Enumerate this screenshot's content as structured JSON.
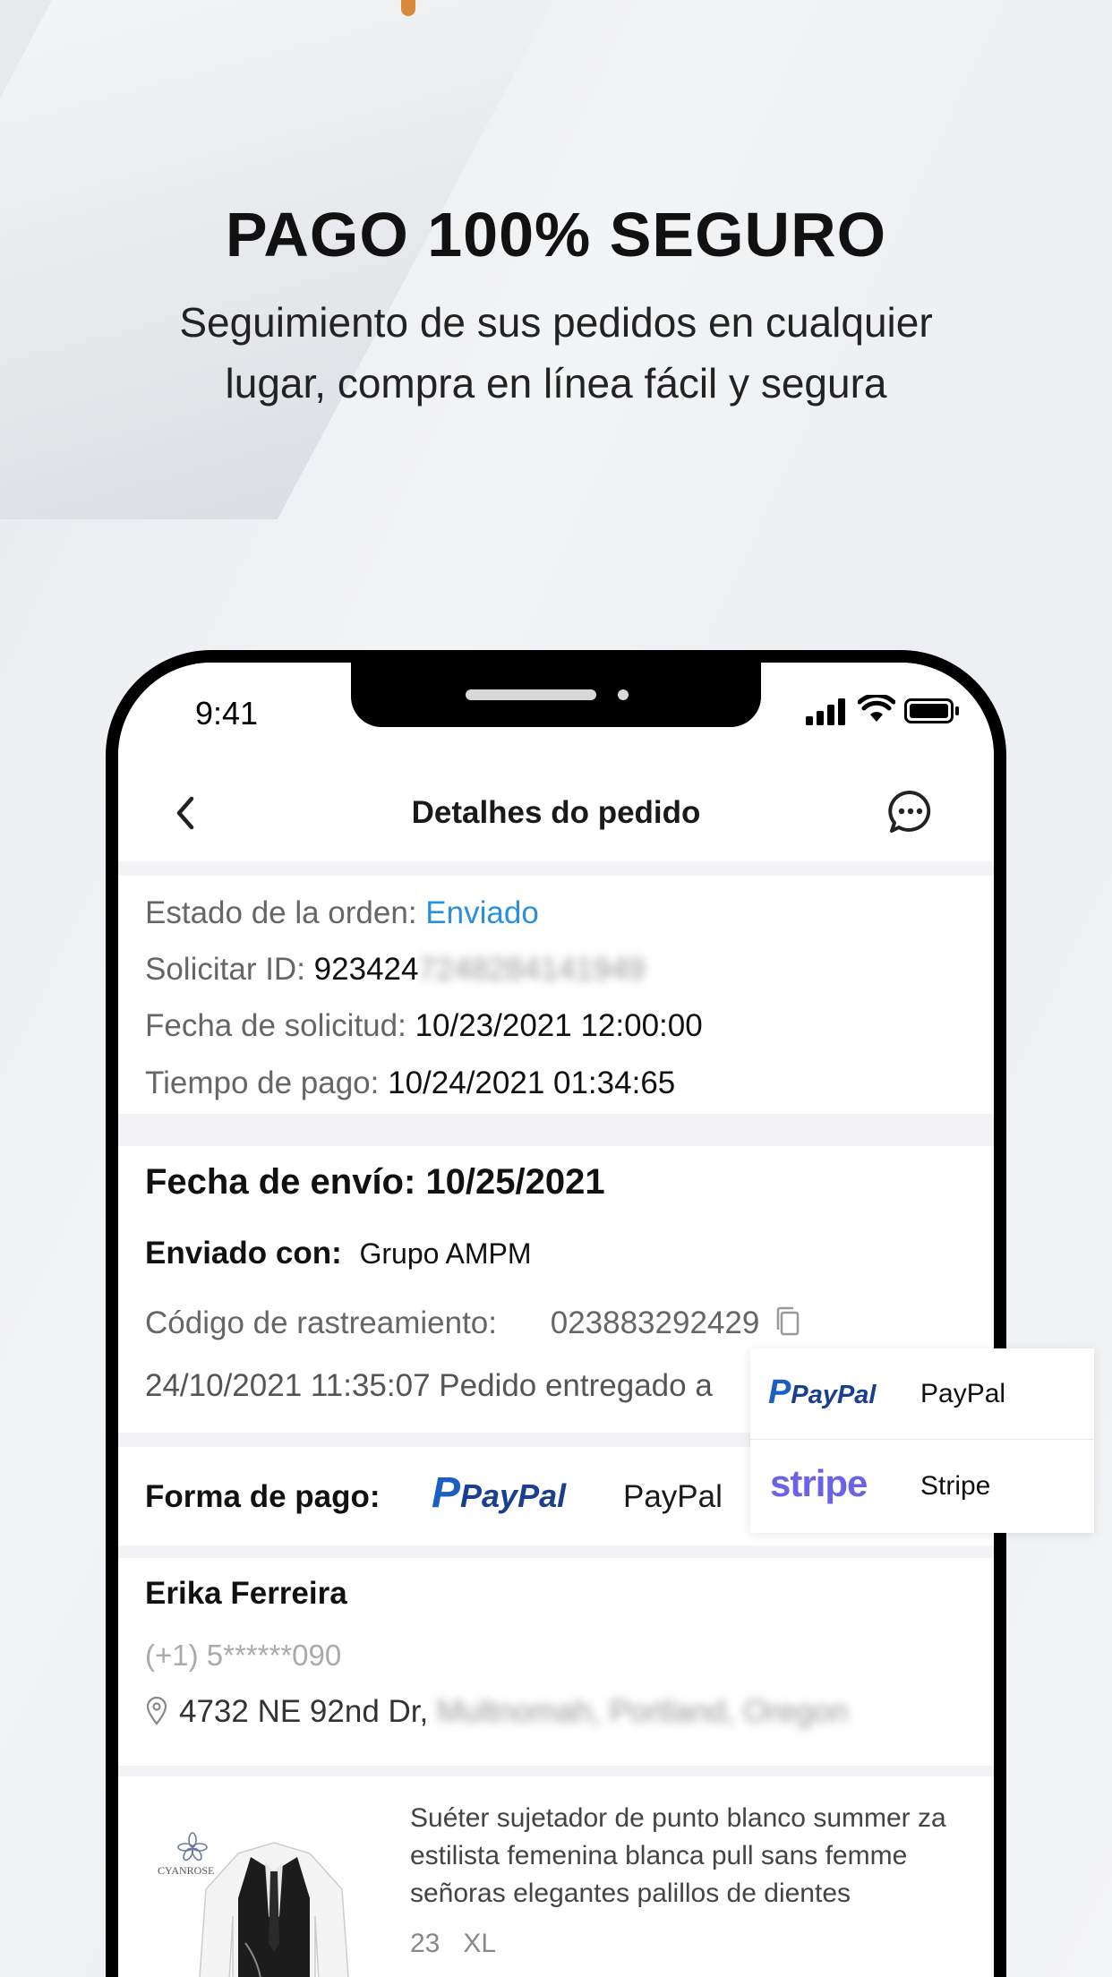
{
  "promo": {
    "headline": "PAGO 100% SEGURO",
    "subline": "Seguimiento de sus pedidos en cualquier lugar, compra en línea fácil y segura"
  },
  "status_bar": {
    "time": "9:41"
  },
  "nav": {
    "title": "Detalhes do pedido"
  },
  "order": {
    "status_label": "Estado de la orden:",
    "status_value": "Enviado",
    "id_label": "Solicitar ID:",
    "id_value": "923424",
    "id_hidden": "7248284141949",
    "date_label": "Fecha de solicitud:",
    "date_value": "10/23/2021 12:00:00",
    "pay_time_label": "Tiempo de pago:",
    "pay_time_value": "10/24/2021 01:34:65"
  },
  "shipping": {
    "ship_date_label": "Fecha de envío:",
    "ship_date_value": "10/25/2021",
    "carrier_label": "Enviado con:",
    "carrier_value": "Grupo AMPM",
    "tracking_label": "Código de rastreamiento:",
    "tracking_value": "023883292429",
    "last_event": "24/10/2021 11:35:07 Pedido entregado a"
  },
  "payment": {
    "label": "Forma de pago:",
    "method_logo": "PayPal",
    "method_name": "PayPal"
  },
  "payment_options": [
    {
      "logo": "PayPal",
      "label": "PayPal"
    },
    {
      "logo": "stripe",
      "label": "Stripe"
    }
  ],
  "customer": {
    "name": "Erika Ferreira",
    "phone": "(+1) 5******090",
    "address_visible": "4732 NE 92nd Dr,",
    "address_hidden": "Multnomah, Portland, Oregon"
  },
  "product": {
    "brand": "CYANROSE",
    "title": "Suéter sujetador de punto blanco summer za estilista femenina blanca pull sans femme señoras elegantes palillos de dientes",
    "quantity": "23",
    "size": "XL"
  },
  "colors": {
    "accent_blue": "#2a8fe0",
    "paypal_dark": "#1b3f8f",
    "paypal_light": "#1c5fc4",
    "stripe_purple": "#6b63e5"
  },
  "icons": [
    "back-icon",
    "chat-icon",
    "copy-icon",
    "location-pin-icon",
    "signal-icon",
    "wifi-icon",
    "battery-icon"
  ]
}
